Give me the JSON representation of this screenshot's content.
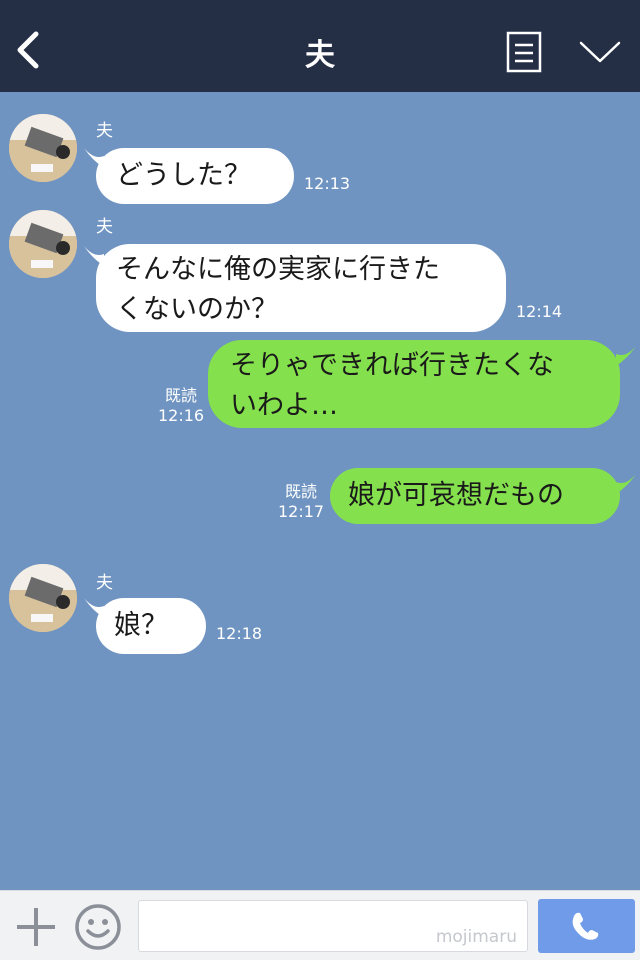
{
  "header": {
    "title": "夫"
  },
  "messages": [
    {
      "side": "in",
      "sender": "夫",
      "text": "どうした？",
      "time": "12:13"
    },
    {
      "side": "in",
      "sender": "夫",
      "text_lines": [
        "そんなに俺の実家に行きた",
        "くないのか？"
      ],
      "time": "12:14"
    },
    {
      "side": "out",
      "read": "既読",
      "text_lines": [
        "そりゃできれば行きたくな",
        "いわよ…"
      ],
      "time": "12:16"
    },
    {
      "side": "out",
      "read": "既読",
      "text": "娘が可哀想だもの",
      "time": "12:17"
    },
    {
      "side": "in",
      "sender": "夫",
      "text": "娘？",
      "time": "12:18"
    }
  ],
  "footer": {
    "watermark": "mojimaru"
  },
  "colors": {
    "header_bg": "#242e45",
    "chat_bg": "#7094c1",
    "incoming_bubble": "#ffffff",
    "outgoing_bubble": "#84e04c",
    "call_button": "#6f9be8"
  },
  "icons": [
    "back-chevron-icon",
    "notes-icon",
    "chevron-down-icon",
    "plus-icon",
    "emoji-icon",
    "phone-icon"
  ]
}
